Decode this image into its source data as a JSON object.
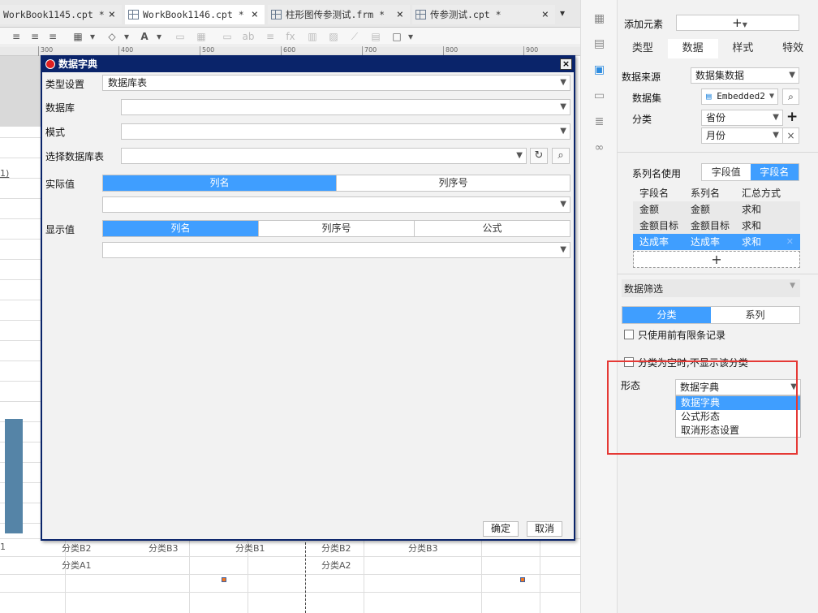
{
  "tabs": [
    {
      "label": "WorkBook1145.cpt *",
      "active": false
    },
    {
      "label": "WorkBook1146.cpt *",
      "active": true
    },
    {
      "label": "柱形图传参测试.frm *",
      "active": false
    },
    {
      "label": "传参测试.cpt *",
      "active": false
    }
  ],
  "tab_close": "×",
  "ruler_ticks": [
    "300",
    "400",
    "500",
    "600",
    "700",
    "800",
    "900"
  ],
  "canvas": {
    "partial_label": "1)",
    "bottom_labels_row1": [
      "1",
      "分类B2",
      "分类B3",
      "分类B1",
      "分类B2",
      "分类B3"
    ],
    "bottom_labels_row2": [
      "分类A1",
      "分类A2"
    ]
  },
  "dialog": {
    "title": "数据字典",
    "close": "×",
    "type_label": "类型设置",
    "type_value": "数据库表",
    "database_label": "数据库",
    "database_value": "",
    "schema_label": "模式",
    "schema_value": "",
    "table_label": "选择数据库表",
    "table_value": "",
    "actual_label": "实际值",
    "actual_tabs": [
      "列名",
      "列序号"
    ],
    "actual_active": 0,
    "display_label": "显示值",
    "display_tabs": [
      "列名",
      "列序号",
      "公式"
    ],
    "display_active": 0,
    "ok": "确定",
    "cancel": "取消"
  },
  "panel": {
    "add_element_label": "添加元素",
    "add_element_value": "+",
    "tabs": [
      "类型",
      "数据",
      "样式",
      "特效"
    ],
    "active_tab": 1,
    "data_source_label": "数据来源",
    "data_source_value": "数据集数据",
    "dataset_label": "数据集",
    "dataset_value": "Embedded2",
    "category_label": "分类",
    "category_values": [
      "省份",
      "月份"
    ],
    "series_name_label": "系列名使用",
    "series_name_options": [
      "字段值",
      "字段名"
    ],
    "series_name_active": 1,
    "series_table": {
      "headers": [
        "字段名",
        "系列名",
        "汇总方式"
      ],
      "rows": [
        [
          "金额",
          "金额",
          "求和"
        ],
        [
          "金额目标",
          "金额目标",
          "求和"
        ],
        [
          "达成率",
          "达成率",
          "求和"
        ]
      ],
      "selected_row": 2,
      "add": "+"
    },
    "filter_label": "数据筛选",
    "filter_tabs": [
      "分类",
      "系列"
    ],
    "filter_active": 0,
    "check_limited": "只使用前有限条记录",
    "check_hide_empty": "分类为空时,不显示该分类",
    "form_label": "形态",
    "form_value": "数据字典",
    "form_options": [
      "数据字典",
      "公式形态",
      "取消形态设置"
    ],
    "form_selected": 0
  },
  "colors": {
    "accent": "#3f9eff",
    "dialog_title": "#0a246a",
    "highlight": "#e53935",
    "bar": "#5584a7"
  }
}
